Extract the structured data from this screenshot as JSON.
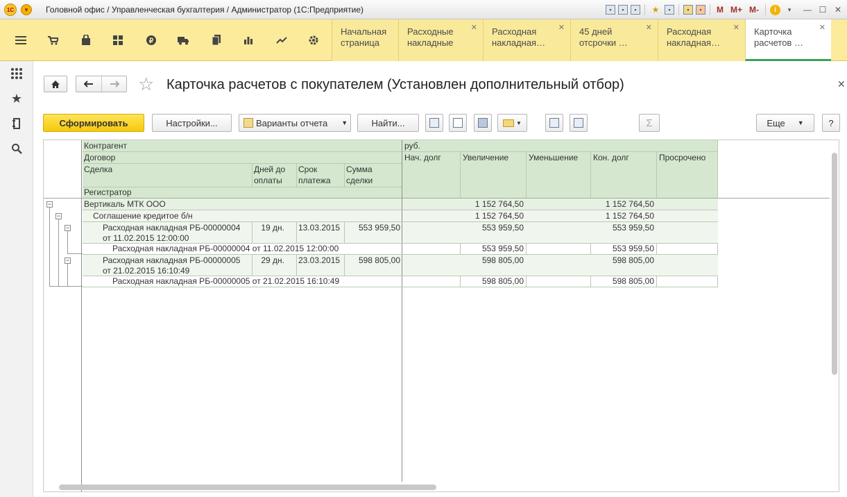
{
  "window": {
    "title": "Головной офис / Управленческая бухгалтерия / Администратор  (1С:Предприятие)",
    "logo_text": "1С",
    "m_labels": [
      "M",
      "M+",
      "M-"
    ]
  },
  "sections": [
    {
      "name": "menu-icon"
    },
    {
      "name": "cart-icon"
    },
    {
      "name": "bag-icon"
    },
    {
      "name": "grid-icon"
    },
    {
      "name": "ruble-icon"
    },
    {
      "name": "truck-icon"
    },
    {
      "name": "documents-icon"
    },
    {
      "name": "bar-chart-icon"
    },
    {
      "name": "trend-icon"
    },
    {
      "name": "gear-icon"
    }
  ],
  "tabs": [
    {
      "line1": "Начальная",
      "line2": "страница",
      "closable": false
    },
    {
      "line1": "Расходные",
      "line2": "накладные",
      "closable": true
    },
    {
      "line1": "Расходная",
      "line2": "накладная…",
      "closable": true
    },
    {
      "line1": "45 дней",
      "line2": "отсрочки …",
      "closable": true
    },
    {
      "line1": "Расходная",
      "line2": "накладная…",
      "closable": true
    },
    {
      "line1": "Карточка",
      "line2": "расчетов …",
      "closable": true
    }
  ],
  "form": {
    "title": "Карточка расчетов с покупателем (Установлен дополнительный отбор)"
  },
  "commands": {
    "generate": "Сформировать",
    "settings": "Настройки...",
    "variants": "Варианты отчета",
    "find": "Найти...",
    "more": "Еще",
    "help": "?",
    "sum": "Σ"
  },
  "report": {
    "currency": "руб.",
    "headers": {
      "counterparty": "Контрагент",
      "contract": "Договор",
      "deal": "Сделка",
      "days_line1": "Дней до",
      "days_line2": "оплаты",
      "term_line1": "Срок",
      "term_line2": "платежа",
      "sum_line1": "Сумма",
      "sum_line2": "сделки",
      "registrar": "Регистратор",
      "start_debt": "Нач. долг",
      "increase": "Увеличение",
      "decrease": "Уменьшение",
      "end_debt": "Кон. долг",
      "overdue": "Просрочено"
    },
    "rows": [
      {
        "label": "Вертикаль МТК ООО",
        "increase": "1 152 764,50",
        "end_debt": "1 152 764,50"
      },
      {
        "label": "Соглашение кредитое б/н",
        "increase": "1 152 764,50",
        "end_debt": "1 152 764,50"
      },
      {
        "label1": "Расходная накладная РБ-00000004",
        "label2": "от 11.02.2015 12:00:00",
        "days": "19 дн.",
        "term": "13.03.2015",
        "sum": "553 959,50",
        "increase": "553 959,50",
        "end_debt": "553 959,50"
      },
      {
        "label": "Расходная накладная РБ-00000004 от 11.02.2015 12:00:00",
        "increase": "553 959,50",
        "end_debt": "553 959,50"
      },
      {
        "label1": "Расходная накладная РБ-00000005",
        "label2": "от 21.02.2015 16:10:49",
        "days": "29 дн.",
        "term": "23.03.2015",
        "sum": "598 805,00",
        "increase": "598 805,00",
        "end_debt": "598 805,00"
      },
      {
        "label": "Расходная накладная РБ-00000005 от 21.02.2015 16:10:49",
        "increase": "598 805,00",
        "end_debt": "598 805,00"
      }
    ]
  }
}
